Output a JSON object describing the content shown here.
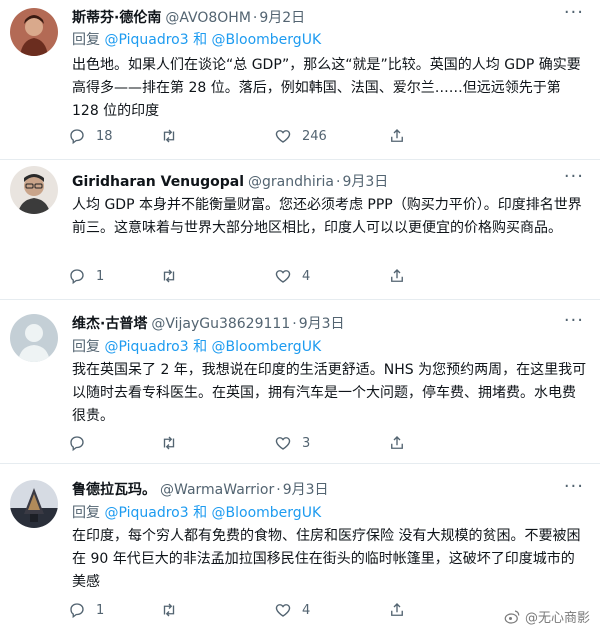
{
  "tweets": [
    {
      "name": "斯蒂芬·德伦南",
      "handle": "@AVO8OHM",
      "date": "9月2日",
      "reply_prefix": "回复",
      "reply_to_1": "@Piquadro3",
      "reply_and": "和",
      "reply_to_2": "@BloombergUK",
      "body": "出色地。如果人们在谈论“总 GDP”，那么这“就是”比较。英国的人均 GDP 确实要高得多——排在第 28 位。落后，例如韩国、法国、爱尔兰……但远远领先于第 128 位的印度",
      "replies": "18",
      "retweets": "",
      "likes": "246",
      "avatar_colors": [
        "#6b2d1f",
        "#d9a98c"
      ]
    },
    {
      "name": "Giridharan Venugopal",
      "handle": "@grandhiria",
      "date": "9月3日",
      "reply_prefix": "",
      "reply_to_1": "",
      "reply_and": "",
      "reply_to_2": "",
      "body": "人均 GDP 本身并不能衡量财富。您还必须考虑 PPP（购买力平价）。印度排名世界前三。这意味着与世界大部分地区相比，印度人可以以更便宜的价格购买商品。",
      "replies": "1",
      "retweets": "",
      "likes": "4",
      "avatar_colors": [
        "#3b3b3b",
        "#c9a48a"
      ]
    },
    {
      "name": "维杰·古普塔",
      "handle": "@VijayGu38629111",
      "date": "9月3日",
      "reply_prefix": "回复",
      "reply_to_1": "@Piquadro3",
      "reply_and": "和",
      "reply_to_2": "@BloombergUK",
      "body": "我在英国呆了 2 年，我想说在印度的生活更舒适。NHS 为您预约两周，在这里我可以随时去看专科医生。在英国，拥有汽车是一个大问题，停车费、拥堵费。水电费很贵。",
      "replies": "",
      "retweets": "",
      "likes": "3",
      "avatar_colors": [
        "#c4cfd6",
        "#eef3f4"
      ]
    },
    {
      "name": "鲁德拉瓦玛。",
      "handle": "@WarmaWarrior",
      "date": "9月3日",
      "reply_prefix": "回复",
      "reply_to_1": "@Piquadro3",
      "reply_and": "和",
      "reply_to_2": "@BloombergUK",
      "body": "在印度，每个穷人都有免费的食物、住房和医疗保险 没有大规模的贫困。不要被困在 90 年代巨大的非法孟加拉国移民住在街头的临时帐篷里，这破坏了印度城市的美感",
      "replies": "1",
      "retweets": "",
      "likes": "4",
      "avatar_colors": [
        "#2a2f3a",
        "#b08a5a"
      ]
    }
  ],
  "more_label": "···",
  "watermark": "@无心商影",
  "colors": {
    "link": "#1d9bf0",
    "muted": "#536471",
    "text": "#0f1419",
    "divider": "#e6ecf0"
  }
}
